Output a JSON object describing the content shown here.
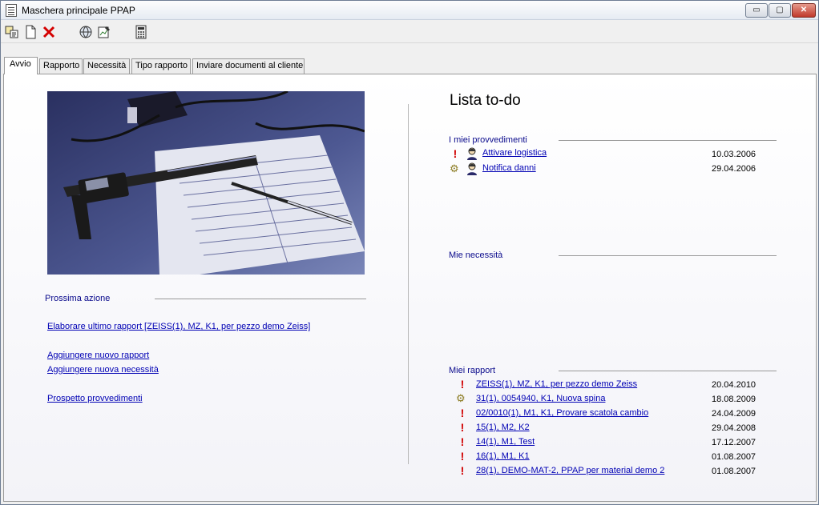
{
  "window": {
    "title": "Maschera principale PPAP"
  },
  "window_buttons": {
    "minimize": "▭",
    "maximize": "▢",
    "close": "✕"
  },
  "toolbar": {
    "icons": [
      "copy-icon",
      "new-document-icon",
      "delete-icon",
      "globe-icon",
      "report-edit-icon",
      "calculator-icon"
    ]
  },
  "tabs": [
    {
      "label": "Avvio",
      "active": true
    },
    {
      "label": "Rapporto"
    },
    {
      "label": "Necessità"
    },
    {
      "label": "Tipo rapporto"
    },
    {
      "label": "Inviare documenti al cliente"
    }
  ],
  "left": {
    "next_action_label": "Prossima azione",
    "links": {
      "edit_last": "Elaborare ultimo rapport [ZEISS(1), MZ, K1, per pezzo demo Zeiss]",
      "add_report": "Aggiungere nuovo rapport",
      "add_need": "Aggiungere nuova necessità",
      "overview": "Prospetto provvedimenti"
    }
  },
  "todo": {
    "title": "Lista to-do",
    "my_actions_label": "I miei provvedimenti",
    "my_actions": [
      {
        "text": "Attivare logistica",
        "date": "10.03.2006",
        "status": "urgent"
      },
      {
        "text": "Notifica danni",
        "date": "29.04.2006",
        "status": "in-progress"
      }
    ],
    "my_needs_label": "Mie necessità",
    "my_reports_label": "Miei rapport",
    "my_reports": [
      {
        "text": "ZEISS(1), MZ, K1, per pezzo demo Zeiss",
        "date": "20.04.2010",
        "status": "urgent"
      },
      {
        "text": "31(1), 0054940, K1, Nuova spina",
        "date": "18.08.2009",
        "status": "in-progress"
      },
      {
        "text": "02/0010(1), M1, K1, Provare scatola cambio",
        "date": "24.04.2009",
        "status": "urgent"
      },
      {
        "text": "15(1), M2, K2",
        "date": "29.04.2008",
        "status": "urgent"
      },
      {
        "text": "14(1), M1, Test",
        "date": "17.12.2007",
        "status": "urgent"
      },
      {
        "text": "16(1), M1, K1",
        "date": "01.08.2007",
        "status": "urgent"
      },
      {
        "text": "28(1), DEMO-MAT-2, PPAP per material demo 2",
        "date": "01.08.2007",
        "status": "urgent"
      }
    ]
  },
  "colors": {
    "link": "#0000b4",
    "section": "#0a0a8c",
    "urgent": "#d00000"
  }
}
